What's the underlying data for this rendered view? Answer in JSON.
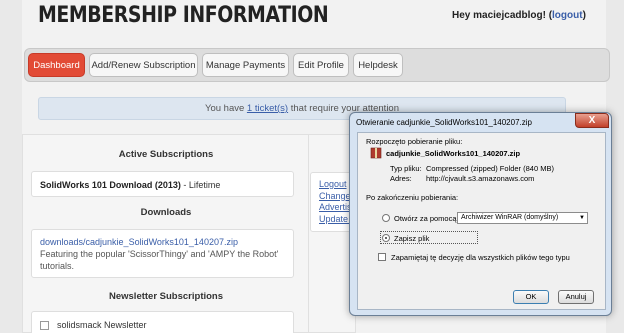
{
  "header": {
    "title": "MEMBERSHIP INFORMATION",
    "greeting": "Hey maciejcadblog! (",
    "logout": "logout",
    "greeting_end": ")"
  },
  "nav": {
    "items": [
      {
        "label": "Dashboard"
      },
      {
        "label": "Add/Renew Subscription"
      },
      {
        "label": "Manage Payments"
      },
      {
        "label": "Edit Profile"
      },
      {
        "label": "Helpdesk"
      }
    ]
  },
  "alert": {
    "before": "You have ",
    "link": "1 ticket(s)",
    "after": " that require your attention"
  },
  "active_subscriptions": {
    "heading": "Active Subscriptions",
    "name": "SolidWorks 101 Download (2013)",
    "suffix": " - Lifetime"
  },
  "downloads": {
    "heading": "Downloads",
    "link": "downloads/cadjunkie_SolidWorks101_140207.zip",
    "description": "Featuring the popular 'ScissorThingy' and 'AMPY the Robot' tutorials."
  },
  "newsletter": {
    "heading": "Newsletter Subscriptions",
    "item": "solidsmack Newsletter"
  },
  "right_links": [
    "Logout",
    "Change",
    "Advertis",
    "Update C"
  ],
  "dialog": {
    "title": "Otwieranie cadjunkie_SolidWorks101_140207.zip",
    "close": "X",
    "intro": "Rozpoczęto pobieranie pliku:",
    "filename": "cadjunkie_SolidWorks101_140207.zip",
    "type_label": "Typ pliku:",
    "type_value": "Compressed (zipped) Folder (840 MB)",
    "from_label": "Adres:",
    "from_value": "http://cjvault.s3.amazonaws.com",
    "after_label": "Po zakończeniu pobierania:",
    "open_with": "Otwórz za pomocą",
    "open_with_app": "Archiwizer WinRAR (domyślny)",
    "save_file": "Zapisz plik",
    "remember": "Zapamiętaj tę decyzję dla wszystkich plików tego typu",
    "ok": "OK",
    "cancel": "Anuluj"
  }
}
